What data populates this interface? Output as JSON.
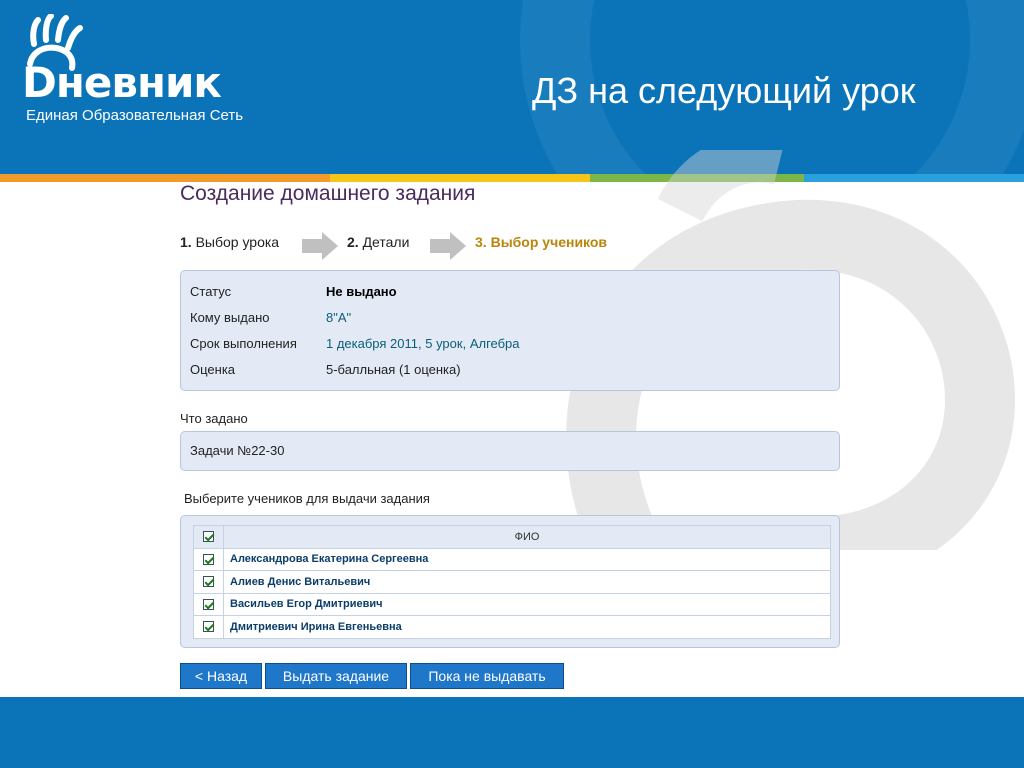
{
  "logo": {
    "name": "Dневник",
    "tagline": "Единая Образовательная Сеть"
  },
  "slide": {
    "title": "ДЗ на следующий урок"
  },
  "colors": {
    "header": "#0b74b9",
    "stripes": [
      "#f39a2b",
      "#f5c518",
      "#7ab648",
      "#2aa0de"
    ],
    "heading": "#4a2b5c",
    "button": "#1e77c9"
  },
  "page": {
    "heading": "Создание домашнего задания"
  },
  "steps": [
    {
      "num": "1.",
      "label": "Выбор урока",
      "active": false
    },
    {
      "num": "2.",
      "label": "Детали",
      "active": false
    },
    {
      "num": "3.",
      "label": "Выбор учеников",
      "active": true
    }
  ],
  "info": {
    "status_label": "Статус",
    "status_value": "Не выдано",
    "assigned_label": "Кому выдано",
    "assigned_value": "8\"А\"",
    "deadline_label": "Срок выполнения",
    "deadline_date": "1 декабря 2011",
    "deadline_lesson": "5 урок",
    "deadline_subject": "Алгебра",
    "grade_label": "Оценка",
    "grade_value": "5-балльная (1 оценка)"
  },
  "task": {
    "label": "Что задано",
    "text": "Задачи №22-30"
  },
  "students": {
    "label": "Выберите учеников для выдачи задания",
    "column_header": "ФИО",
    "select_all_checked": true,
    "rows": [
      {
        "name": "Александрова Екатерина Сергеевна",
        "checked": true
      },
      {
        "name": "Алиев Денис Витальевич",
        "checked": true
      },
      {
        "name": "Васильев Егор Дмитриевич",
        "checked": true
      },
      {
        "name": "Дмитриевич Ирина Евгеньевна",
        "checked": true
      }
    ]
  },
  "buttons": {
    "back": "< Назад",
    "issue": "Выдать задание",
    "hold": "Пока не выдавать"
  }
}
